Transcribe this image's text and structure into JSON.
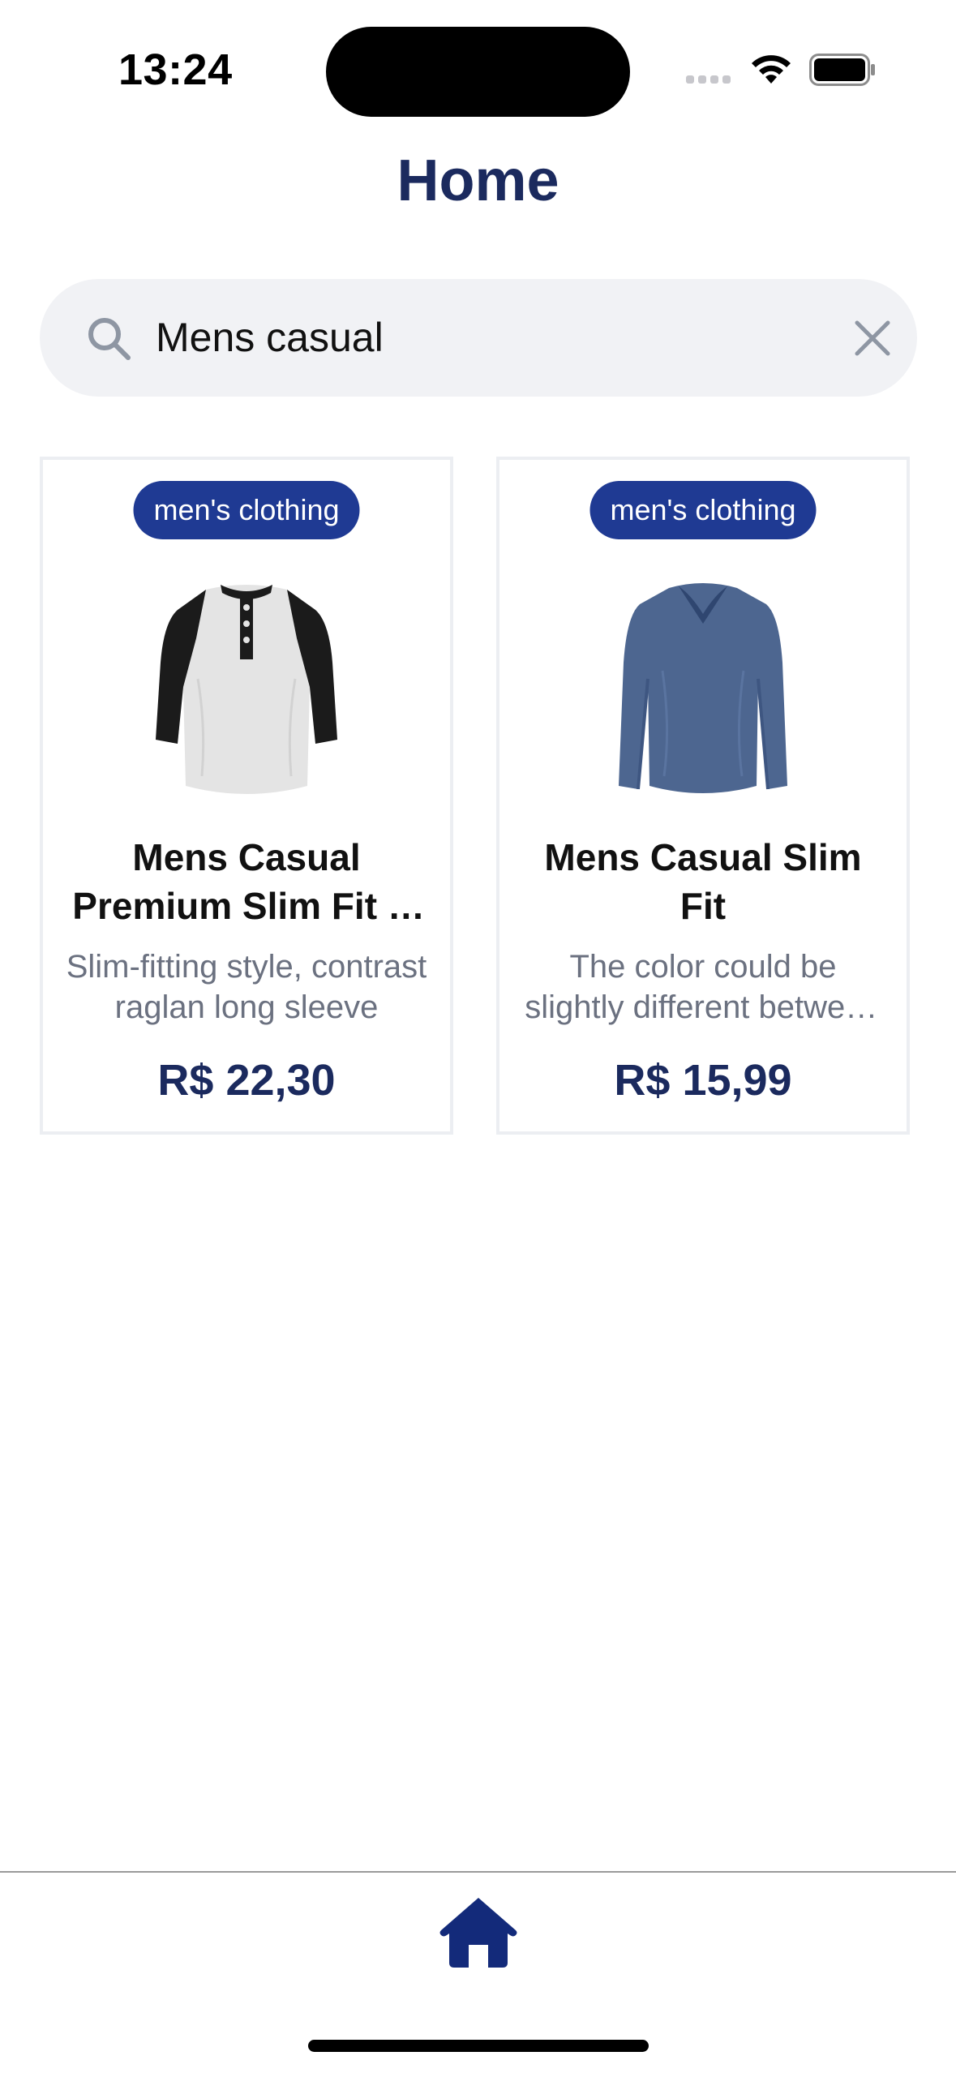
{
  "status_bar": {
    "time": "13:24"
  },
  "header": {
    "title": "Home"
  },
  "search": {
    "value": "Mens casual",
    "placeholder": "",
    "icon": "search-icon",
    "clear_icon": "close-icon"
  },
  "products": [
    {
      "category": "men's clothing",
      "title": "Mens Casual Premium Slim Fit T-Shirts",
      "description": "Slim-fitting style, contrast raglan long sleeve",
      "price": "R$ 22,30"
    },
    {
      "category": "men's clothing",
      "title": "Mens Casual Slim Fit",
      "description": "The color could be slightly different between on the screen and in practice",
      "price": "R$ 15,99"
    }
  ],
  "tab_bar": {
    "items": [
      {
        "icon": "home-icon",
        "active": true
      }
    ]
  },
  "colors": {
    "primary": "#1b2a5e",
    "badge": "#1f3a93",
    "search_bg": "#f1f2f5",
    "muted_text": "#6b7180"
  }
}
